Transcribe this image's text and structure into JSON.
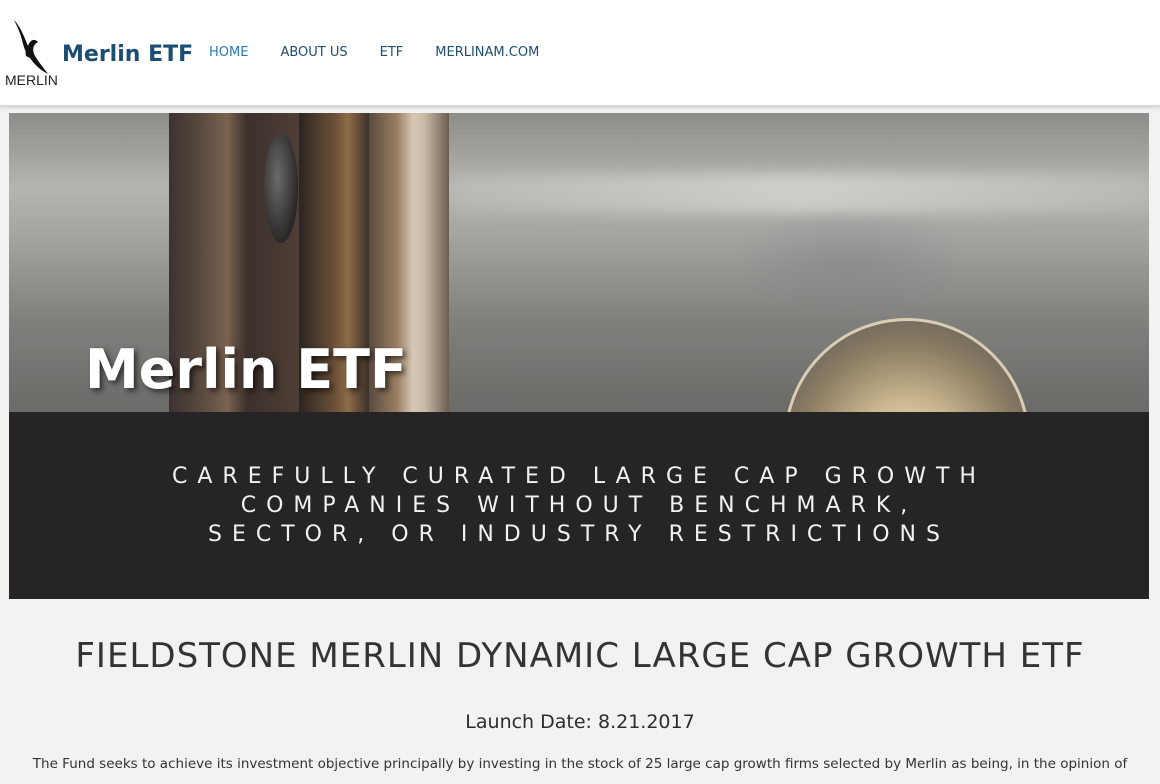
{
  "header": {
    "logo_text": "MERLIN",
    "brand": "Merlin ETF",
    "nav": [
      {
        "label": "HOME"
      },
      {
        "label": "ABOUT US"
      },
      {
        "label": "ETF"
      },
      {
        "label": "MERLINAM.COM"
      }
    ]
  },
  "hero": {
    "title": "Merlin ETF"
  },
  "tagline": {
    "line1": "CAREFULLY CURATED LARGE CAP GROWTH",
    "line2": "COMPANIES WITHOUT BENCHMARK,",
    "line3": "SECTOR, OR INDUSTRY RESTRICTIONS"
  },
  "main": {
    "fund_title": "FIELDSTONE MERLIN DYNAMIC LARGE CAP GROWTH ETF",
    "launch_date": "Launch Date: 8.21.2017",
    "description": "The Fund seeks to achieve its investment objective principally by investing in the stock of 25 large cap growth firms selected by Merlin as being, in the opinion of"
  },
  "colors": {
    "brand": "#1c4e73",
    "nav_active": "#2a7bb0",
    "band": "#262425",
    "page_bg": "#f2f3f1"
  }
}
